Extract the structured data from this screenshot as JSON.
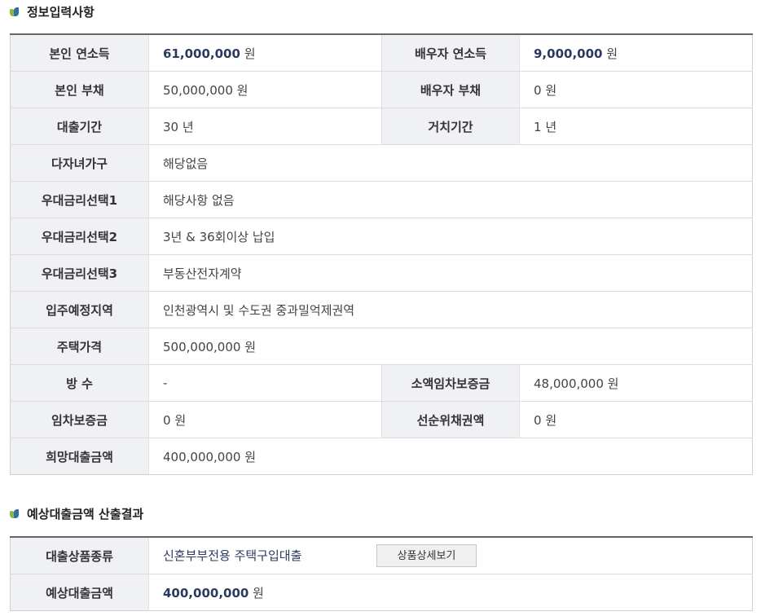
{
  "sections": {
    "input_info": {
      "title": "정보입력사항",
      "rows": {
        "self_income": {
          "label": "본인 연소득",
          "value": "61,000,000",
          "unit": "원"
        },
        "spouse_income": {
          "label": "배우자 연소득",
          "value": "9,000,000",
          "unit": "원"
        },
        "self_debt": {
          "label": "본인 부채",
          "value": "50,000,000",
          "unit": "원"
        },
        "spouse_debt": {
          "label": "배우자 부채",
          "value": "0",
          "unit": "원"
        },
        "loan_period": {
          "label": "대출기간",
          "value": "30",
          "unit": "년"
        },
        "grace_period": {
          "label": "거치기간",
          "value": "1",
          "unit": "년"
        },
        "multi_child": {
          "label": "다자녀가구",
          "value": "해당없음"
        },
        "pref_rate_1": {
          "label": "우대금리선택1",
          "value": "해당사항 없음"
        },
        "pref_rate_2": {
          "label": "우대금리선택2",
          "value": "3년 & 36회이상 납입"
        },
        "pref_rate_3": {
          "label": "우대금리선택3",
          "value": "부동산전자계약"
        },
        "region": {
          "label": "입주예정지역",
          "value": "인천광역시 및 수도권 중과밀억제권역"
        },
        "house_price": {
          "label": "주택가격",
          "value": "500,000,000",
          "unit": "원"
        },
        "rooms": {
          "label": "방 수",
          "value": "-"
        },
        "small_deposit": {
          "label": "소액임차보증금",
          "value": "48,000,000",
          "unit": "원"
        },
        "lease_deposit": {
          "label": "임차보증금",
          "value": "0",
          "unit": "원"
        },
        "senior_bond": {
          "label": "선순위채권액",
          "value": "0",
          "unit": "원"
        },
        "desired_loan": {
          "label": "희망대출금액",
          "value": "400,000,000",
          "unit": "원"
        }
      }
    },
    "result": {
      "title": "예상대출금액 산출결과",
      "product_type": {
        "label": "대출상품종류",
        "value": "신혼부부전용 주택구입대출",
        "button": "상품상세보기"
      },
      "expected_amount": {
        "label": "예상대출금액",
        "value": "400,000,000",
        "unit": "원"
      }
    }
  },
  "colors": {
    "label_bg": "#f0f1f5",
    "highlight_text": "#2a3a5e",
    "table_top_border": "#666666",
    "icon_green": "#8cb83a",
    "icon_blue": "#2f6fa7"
  },
  "icons": {
    "section_bullet": "book-bullet-icon"
  }
}
